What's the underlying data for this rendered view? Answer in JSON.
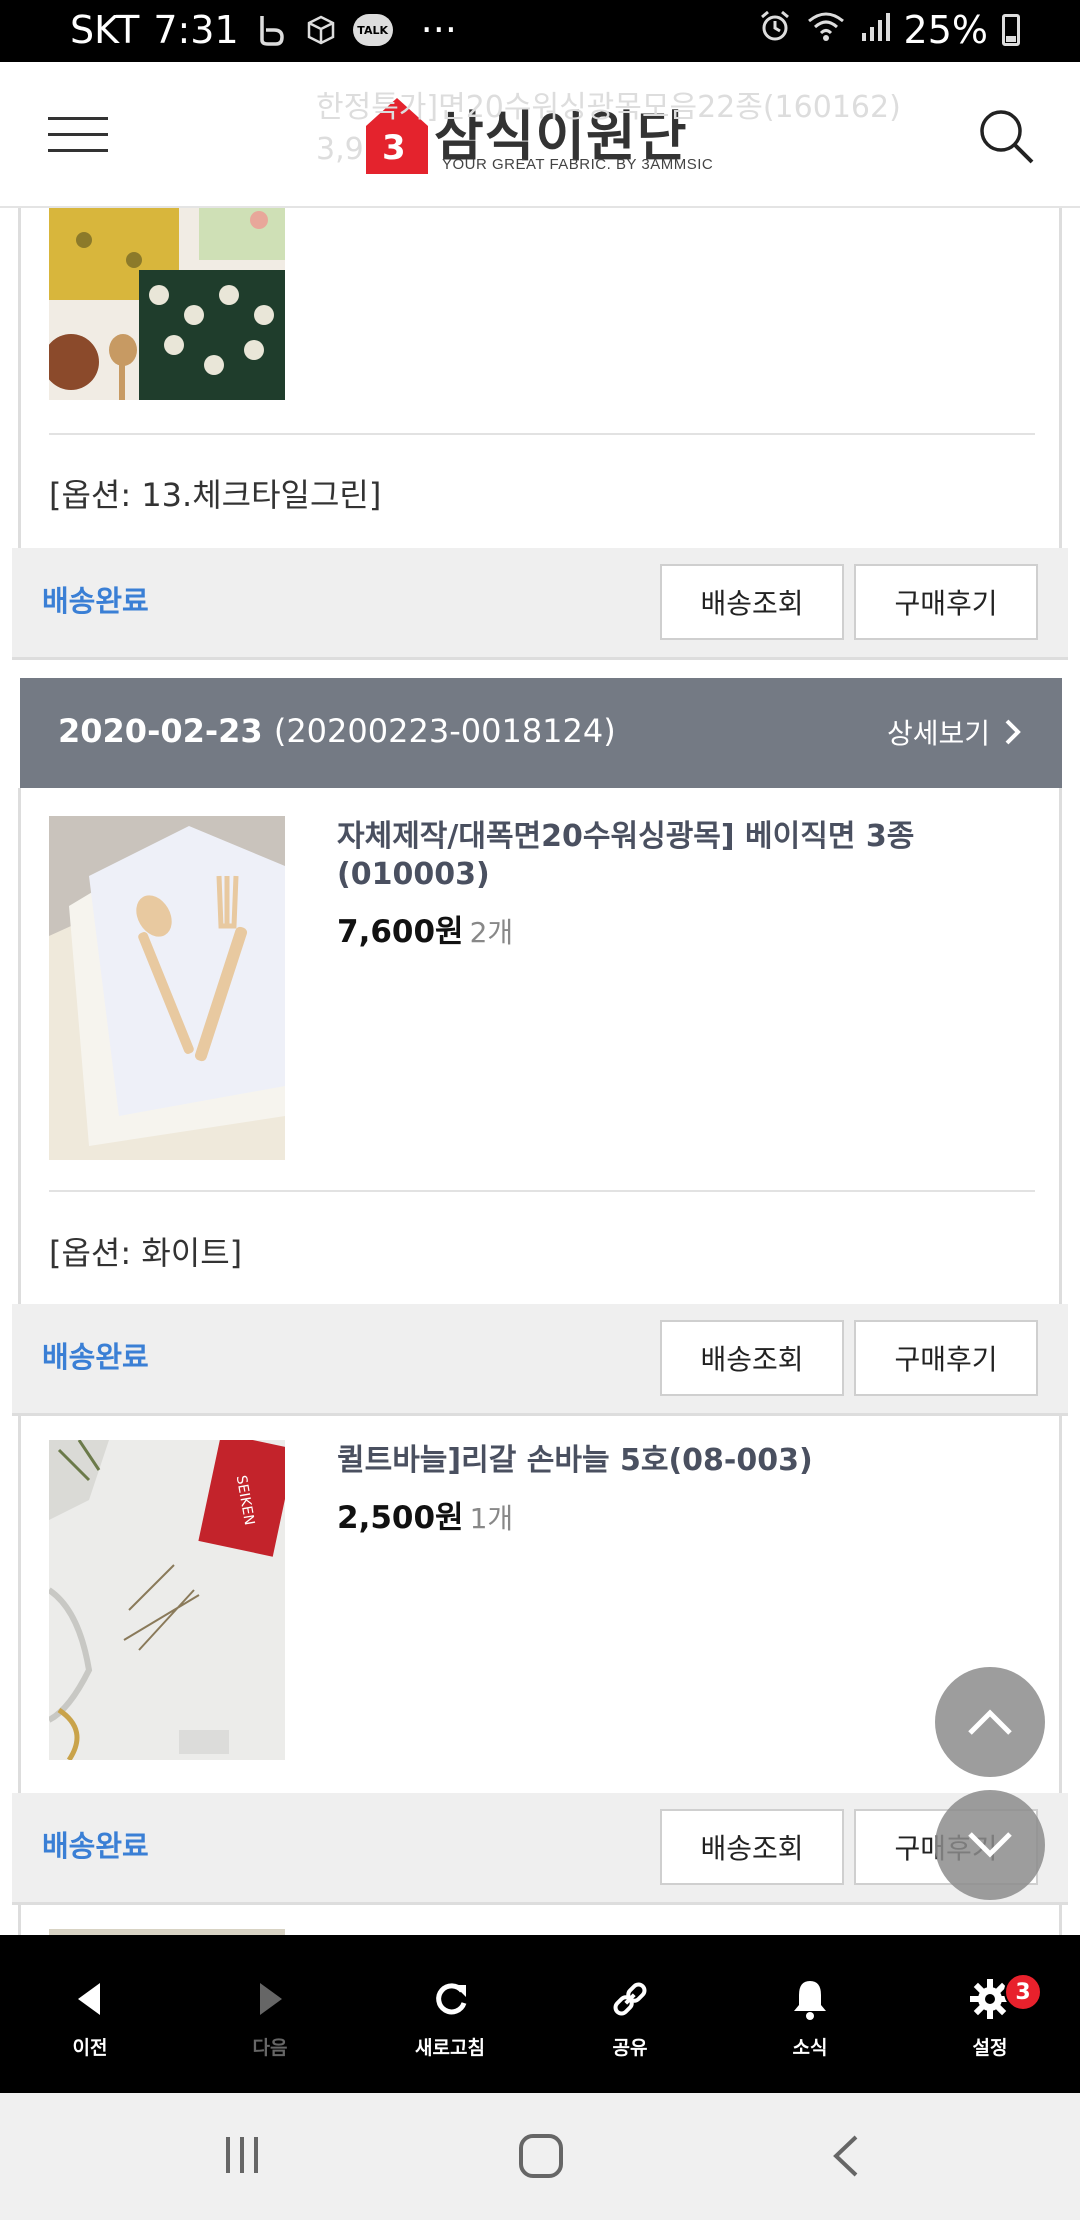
{
  "status_bar": {
    "carrier": "SKT",
    "time": "7:31",
    "notification_icons": [
      "band-icon",
      "box-icon",
      "kakaotalk-icon"
    ],
    "talk_label": "TALK",
    "more": "···",
    "battery": "25%"
  },
  "header": {
    "logo_title": "삼식이원단",
    "logo_badge": "3",
    "logo_subtitle": "YOUR GREAT FABRIC. BY 3AMMSIC",
    "behind_title": "한정특가]면20수워싱광목모음22종(160162)",
    "behind_price": "3,9"
  },
  "orders": [
    {
      "items": [
        {
          "option": "[옵션: 13.체크타일그린]",
          "status": "배송완료",
          "track_button": "배송조회",
          "review_button": "구매후기"
        }
      ]
    },
    {
      "date": "2020-02-23",
      "order_number": "(20200223-0018124)",
      "detail_link": "상세보기",
      "items": [
        {
          "name": "자체제작/대폭면20수워싱광목] 베이직면 3종(010003)",
          "price": "7,600원",
          "qty": "2개",
          "option": "[옵션: 화이트]",
          "status": "배송완료",
          "track_button": "배송조회",
          "review_button": "구매후기"
        },
        {
          "name": "퀼트바늘]리갈 손바늘 5호(08-003)",
          "price": "2,500원",
          "qty": "1개",
          "status": "배송완료",
          "track_button": "배송조회",
          "review_button": "구매후기"
        }
      ]
    }
  ],
  "toolbar": {
    "items": [
      {
        "label": "이전",
        "icon": "back-arrow-icon"
      },
      {
        "label": "다음",
        "icon": "forward-arrow-icon"
      },
      {
        "label": "새로고침",
        "icon": "refresh-icon"
      },
      {
        "label": "공유",
        "icon": "share-link-icon"
      },
      {
        "label": "소식",
        "icon": "bell-icon"
      },
      {
        "label": "설정",
        "icon": "gear-icon",
        "badge": "3"
      }
    ]
  },
  "colors": {
    "accent_blue": "#3a7fd5",
    "order_header_bg": "#747a84",
    "brand_red": "#e4232d",
    "badge_red": "#e8212c"
  }
}
